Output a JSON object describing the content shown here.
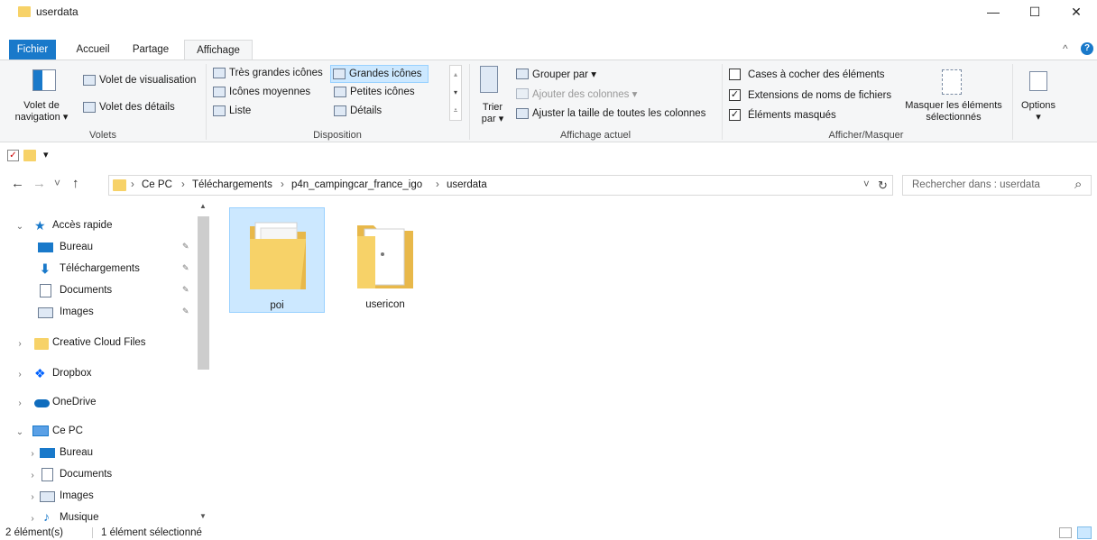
{
  "window": {
    "title": "userdata",
    "minimize": "—",
    "maximize": "☐",
    "close": "✕"
  },
  "tabs": [
    {
      "label": "Fichier"
    },
    {
      "label": "Accueil"
    },
    {
      "label": "Partage"
    },
    {
      "label": "Affichage"
    }
  ],
  "ribbon_collapse": "^",
  "help": "?",
  "ribbon": {
    "volets": {
      "nav_line1": "Volet de",
      "nav_line2": "navigation ▾",
      "preview": "Volet de visualisation",
      "details": "Volet des détails",
      "label": "Volets"
    },
    "disposition": {
      "items": [
        "Très grandes icônes",
        "Grandes icônes",
        "Icônes moyennes",
        "Petites icônes",
        "Liste",
        "Détails"
      ],
      "label": "Disposition"
    },
    "affichage_actuel": {
      "sort_line1": "Trier",
      "sort_line2": "par ▾",
      "group": "Grouper par ▾",
      "add_columns": "Ajouter des colonnes ▾",
      "fit_columns": "Ajuster la taille de toutes les colonnes",
      "label": "Affichage actuel"
    },
    "afficher_masquer": {
      "checkboxes": [
        {
          "label": "Cases à cocher des éléments",
          "checked": "false"
        },
        {
          "label": "Extensions de noms de fichiers",
          "checked": "true"
        },
        {
          "label": "Éléments masqués",
          "checked": "true"
        }
      ],
      "hide_selected_line1": "Masquer les éléments",
      "hide_selected_line2": "sélectionnés",
      "label": "Afficher/Masquer"
    },
    "options": {
      "label": "Options",
      "arrow": "▾"
    }
  },
  "qat": {
    "dropdown": "▾"
  },
  "address": {
    "back": "←",
    "forward": "→",
    "recent": "˅",
    "up": "↑",
    "crumbs": [
      "Ce PC",
      "Téléchargements",
      "p4n_campingcar_france_igo",
      "userdata"
    ],
    "sep": "›",
    "dropdown": "˅",
    "refresh": "↻"
  },
  "search": {
    "placeholder": "Rechercher dans : userdata",
    "icon": "⌕"
  },
  "nav": {
    "quick_access": "Accès rapide",
    "quick_items": [
      "Bureau",
      "Téléchargements",
      "Documents",
      "Images"
    ],
    "pin": "📌",
    "roots": [
      "Creative Cloud Files",
      "Dropbox",
      "OneDrive"
    ],
    "this_pc": "Ce PC",
    "pc_items": [
      "Bureau",
      "Documents",
      "Images",
      "Musique"
    ]
  },
  "files": [
    {
      "name": "poi",
      "selected": "true"
    },
    {
      "name": "usericon",
      "selected": "false"
    }
  ],
  "status": {
    "count": "2 élément(s)",
    "selected": "1 élément sélectionné"
  },
  "colors": {
    "accent": "#1979ca",
    "selection": "#cce8ff",
    "folder": "#f7d268"
  }
}
